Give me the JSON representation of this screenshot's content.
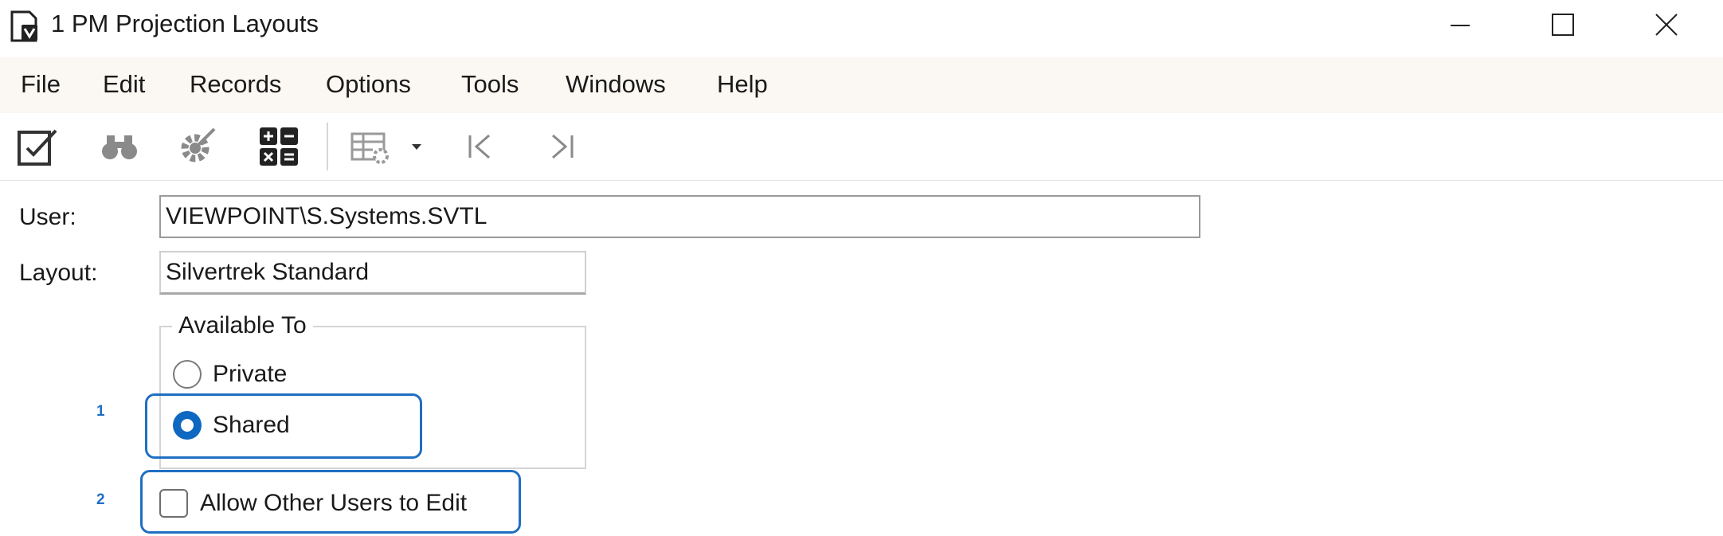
{
  "window": {
    "title": "1 PM Projection Layouts",
    "app_icon": "form-document-icon",
    "controls": [
      "minimize-icon",
      "maximize-icon",
      "close-icon"
    ]
  },
  "menu": {
    "items": [
      "File",
      "Edit",
      "Records",
      "Options",
      "Tools",
      "Windows",
      "Help"
    ]
  },
  "toolbar": {
    "icons": [
      "save-record-icon",
      "find-binoculars-icon",
      "settings-gear-icon",
      "calculator-icon",
      "grid-settings-icon",
      "dropdown-arrow-icon",
      "first-record-icon",
      "last-record-icon"
    ]
  },
  "form": {
    "user_label": "User:",
    "user_value": "VIEWPOINT\\S.Systems.SVTL",
    "layout_label": "Layout:",
    "layout_value": "Silvertrek Standard",
    "available_to": {
      "legend": "Available To",
      "options": [
        {
          "label": "Private",
          "selected": false
        },
        {
          "label": "Shared",
          "selected": true
        }
      ]
    },
    "allow_edit": {
      "label": "Allow Other Users to Edit",
      "checked": false
    }
  },
  "annotations": {
    "callout_1": "1",
    "callout_2": "2",
    "color": "#1f6fc2"
  },
  "colors": {
    "accent": "#0e67c0",
    "menubar_bg": "#fbf7f2"
  }
}
